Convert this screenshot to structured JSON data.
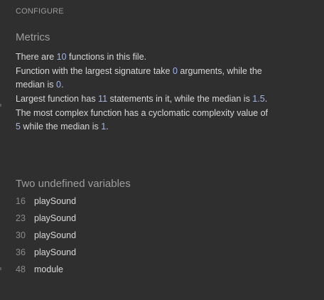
{
  "configure_label": "CONFIGURE",
  "metrics": {
    "title": "Metrics",
    "functions": {
      "pre": "There are ",
      "num": "10",
      "post": " functions in this file."
    },
    "signature": {
      "pre": "Function with the largest signature take ",
      "num1": "0",
      "mid": " arguments, while the median is ",
      "num2": "0",
      "post": "."
    },
    "statements": {
      "pre": "Largest function has ",
      "num1": "11",
      "mid": " statements in it, while the median is ",
      "num2": "1.5",
      "post": "."
    },
    "complexity": {
      "pre": "The most complex function has a cyclomatic complexity value of ",
      "num1": "5",
      "mid": " while the median is ",
      "num2": "1",
      "post": "."
    }
  },
  "undefined": {
    "title": "Two undefined variables",
    "items": [
      {
        "line": "16",
        "name": "playSound"
      },
      {
        "line": "23",
        "name": "playSound"
      },
      {
        "line": "30",
        "name": "playSound"
      },
      {
        "line": "36",
        "name": "playSound"
      },
      {
        "line": "48",
        "name": "module"
      }
    ]
  }
}
